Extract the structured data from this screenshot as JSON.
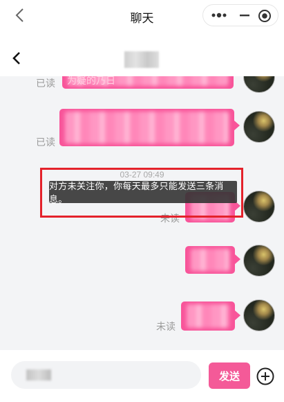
{
  "top_bar": {
    "title": "聊天",
    "back_icon": "chevron-left-icon",
    "capsule": {
      "more_icon": "more-dots-icon",
      "minimize_icon": "minimize-icon",
      "close_icon": "record-circle-icon"
    }
  },
  "chat_header": {
    "back_icon": "chevron-left-icon",
    "peer_name": "██"
  },
  "messages": [
    {
      "status": "已读",
      "text_partial": "为疑的乃日"
    },
    {
      "status": "已读",
      "text": "████████████████"
    },
    {
      "timestamp": "03-27 09:49"
    },
    {
      "status": "未读",
      "text": "████"
    },
    {
      "status": "",
      "text": "████"
    },
    {
      "status": "未读",
      "text": "████"
    }
  ],
  "toast": {
    "text": "对方未关注你，你每天最多只能发送三条消息。",
    "highlight_color": "#e4222b"
  },
  "input_bar": {
    "input_value": "███",
    "send_label": "发送",
    "plus_icon": "plus-circle-icon"
  },
  "colors": {
    "bubble": "#f8559a",
    "send_button": "#f45a98",
    "background": "#f3f4f6"
  }
}
